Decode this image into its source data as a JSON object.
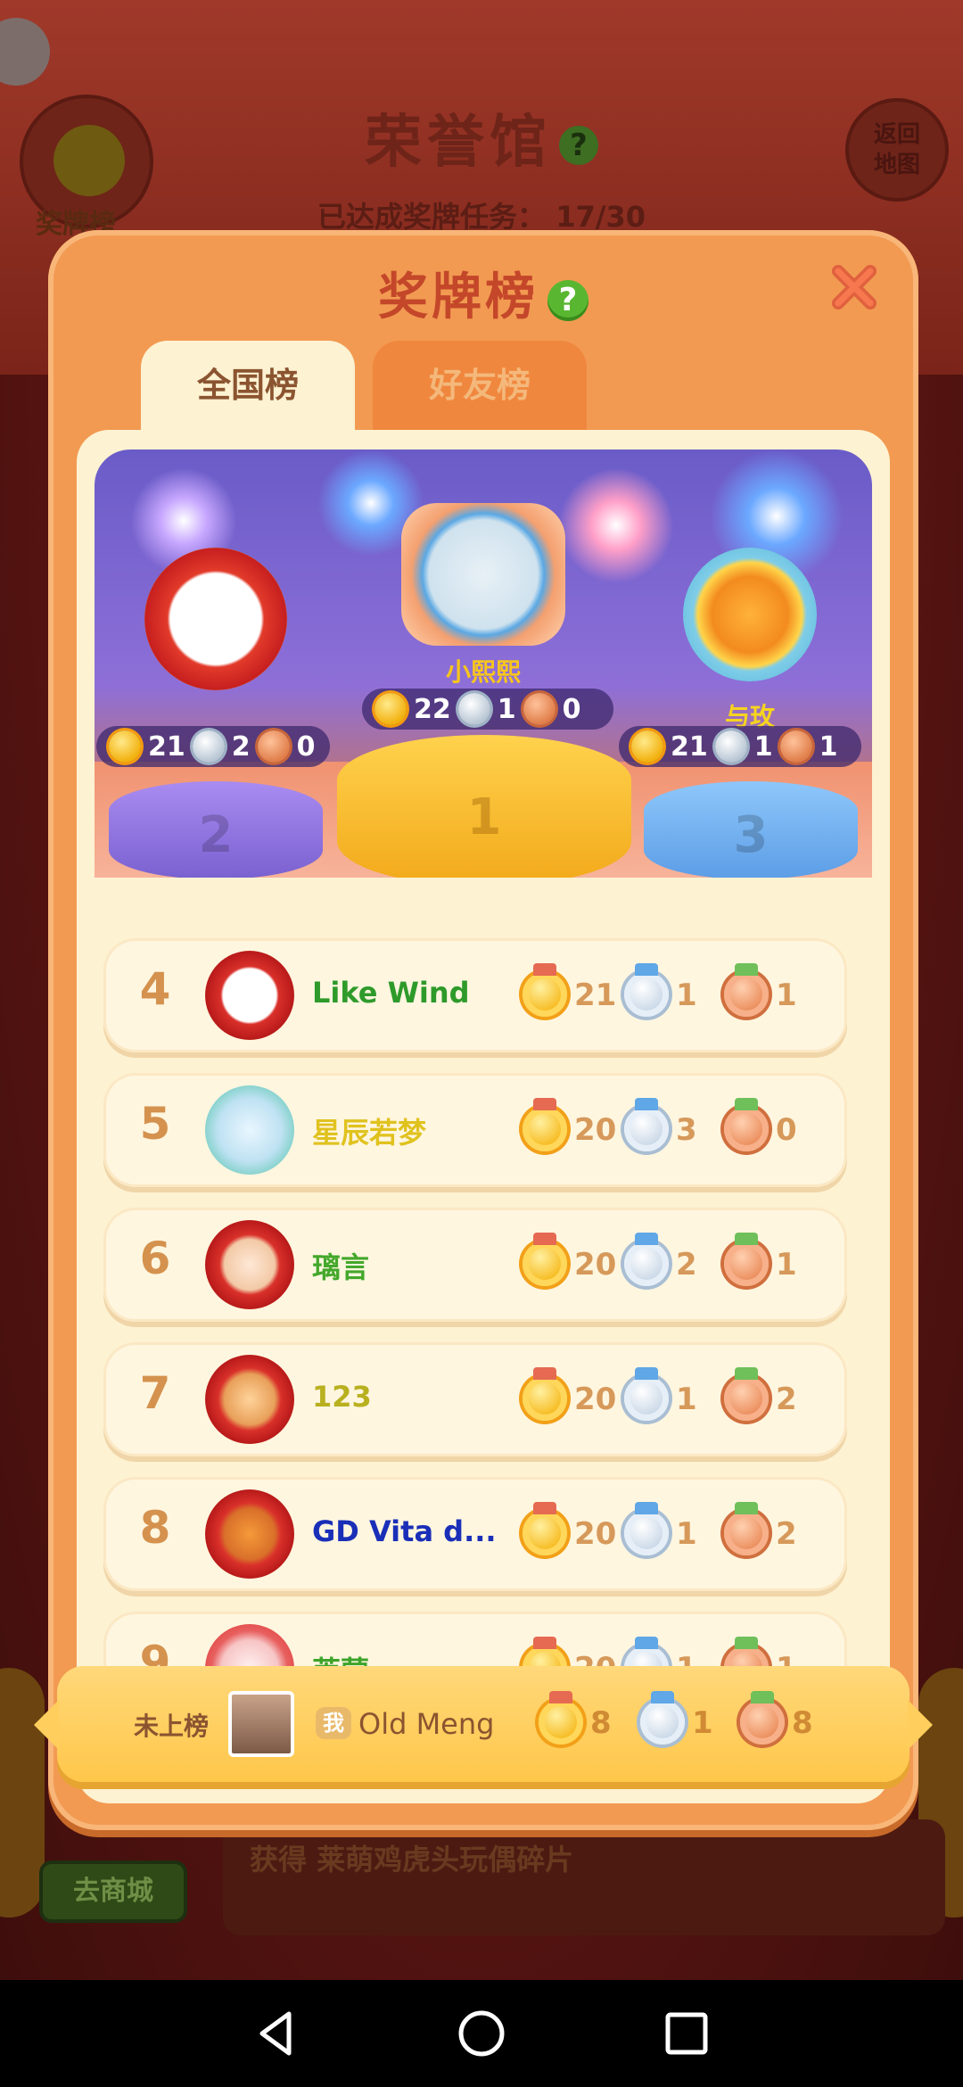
{
  "background": {
    "title": "荣誉馆",
    "progress_label": "已达成奖牌任务：",
    "progress_value": "17/30",
    "medal_button_label": "奖牌榜",
    "back_button_label_1": "返回",
    "back_button_label_2": "地图",
    "bottom_text": "获得 莱萌鸡虎头玩偶碎片",
    "shop_button": "去商城"
  },
  "modal": {
    "title": "奖牌榜",
    "tabs": [
      {
        "label": "全国榜",
        "active": true
      },
      {
        "label": "好友榜",
        "active": false
      }
    ]
  },
  "podium": {
    "first": {
      "rank": "1",
      "name": "小熙熙",
      "gold": "22",
      "silver": "1",
      "bronze": "0"
    },
    "second": {
      "rank": "2",
      "name": "",
      "gold": "21",
      "silver": "2",
      "bronze": "0"
    },
    "third": {
      "rank": "3",
      "name": "与玫",
      "gold": "21",
      "silver": "1",
      "bronze": "1"
    }
  },
  "rows": [
    {
      "rank": "4",
      "name": "Like Wind",
      "name_color": "#2e9a2a",
      "gold": "21",
      "silver": "1",
      "bronze": "1"
    },
    {
      "rank": "5",
      "name": "星辰若梦",
      "name_color": "#e0c21e",
      "gold": "20",
      "silver": "3",
      "bronze": "0"
    },
    {
      "rank": "6",
      "name": "璃言",
      "name_color": "#43a82b",
      "gold": "20",
      "silver": "2",
      "bronze": "1"
    },
    {
      "rank": "7",
      "name": "123",
      "name_color": "#b9b020",
      "gold": "20",
      "silver": "1",
      "bronze": "2"
    },
    {
      "rank": "8",
      "name": "GD Vita d...",
      "name_color": "#1a2fb8",
      "gold": "20",
      "silver": "1",
      "bronze": "2"
    },
    {
      "rank": "9",
      "name": "莱蒙",
      "name_color": "#3da42a",
      "gold": "20",
      "silver": "1",
      "bronze": "1"
    }
  ],
  "me": {
    "status": "未上榜",
    "tag": "我",
    "name": "Old Meng",
    "gold": "8",
    "silver": "1",
    "bronze": "8"
  },
  "colors": {
    "modal": "#f29a52",
    "board": "#fdf2d2",
    "title": "#c4472a",
    "rank_number": "#d4924e",
    "help_icon": "#59b630"
  },
  "icons": {
    "help": "question-icon",
    "close": "close-icon",
    "gold": "gold-medal-icon",
    "silver": "silver-medal-icon",
    "bronze": "bronze-medal-icon"
  }
}
